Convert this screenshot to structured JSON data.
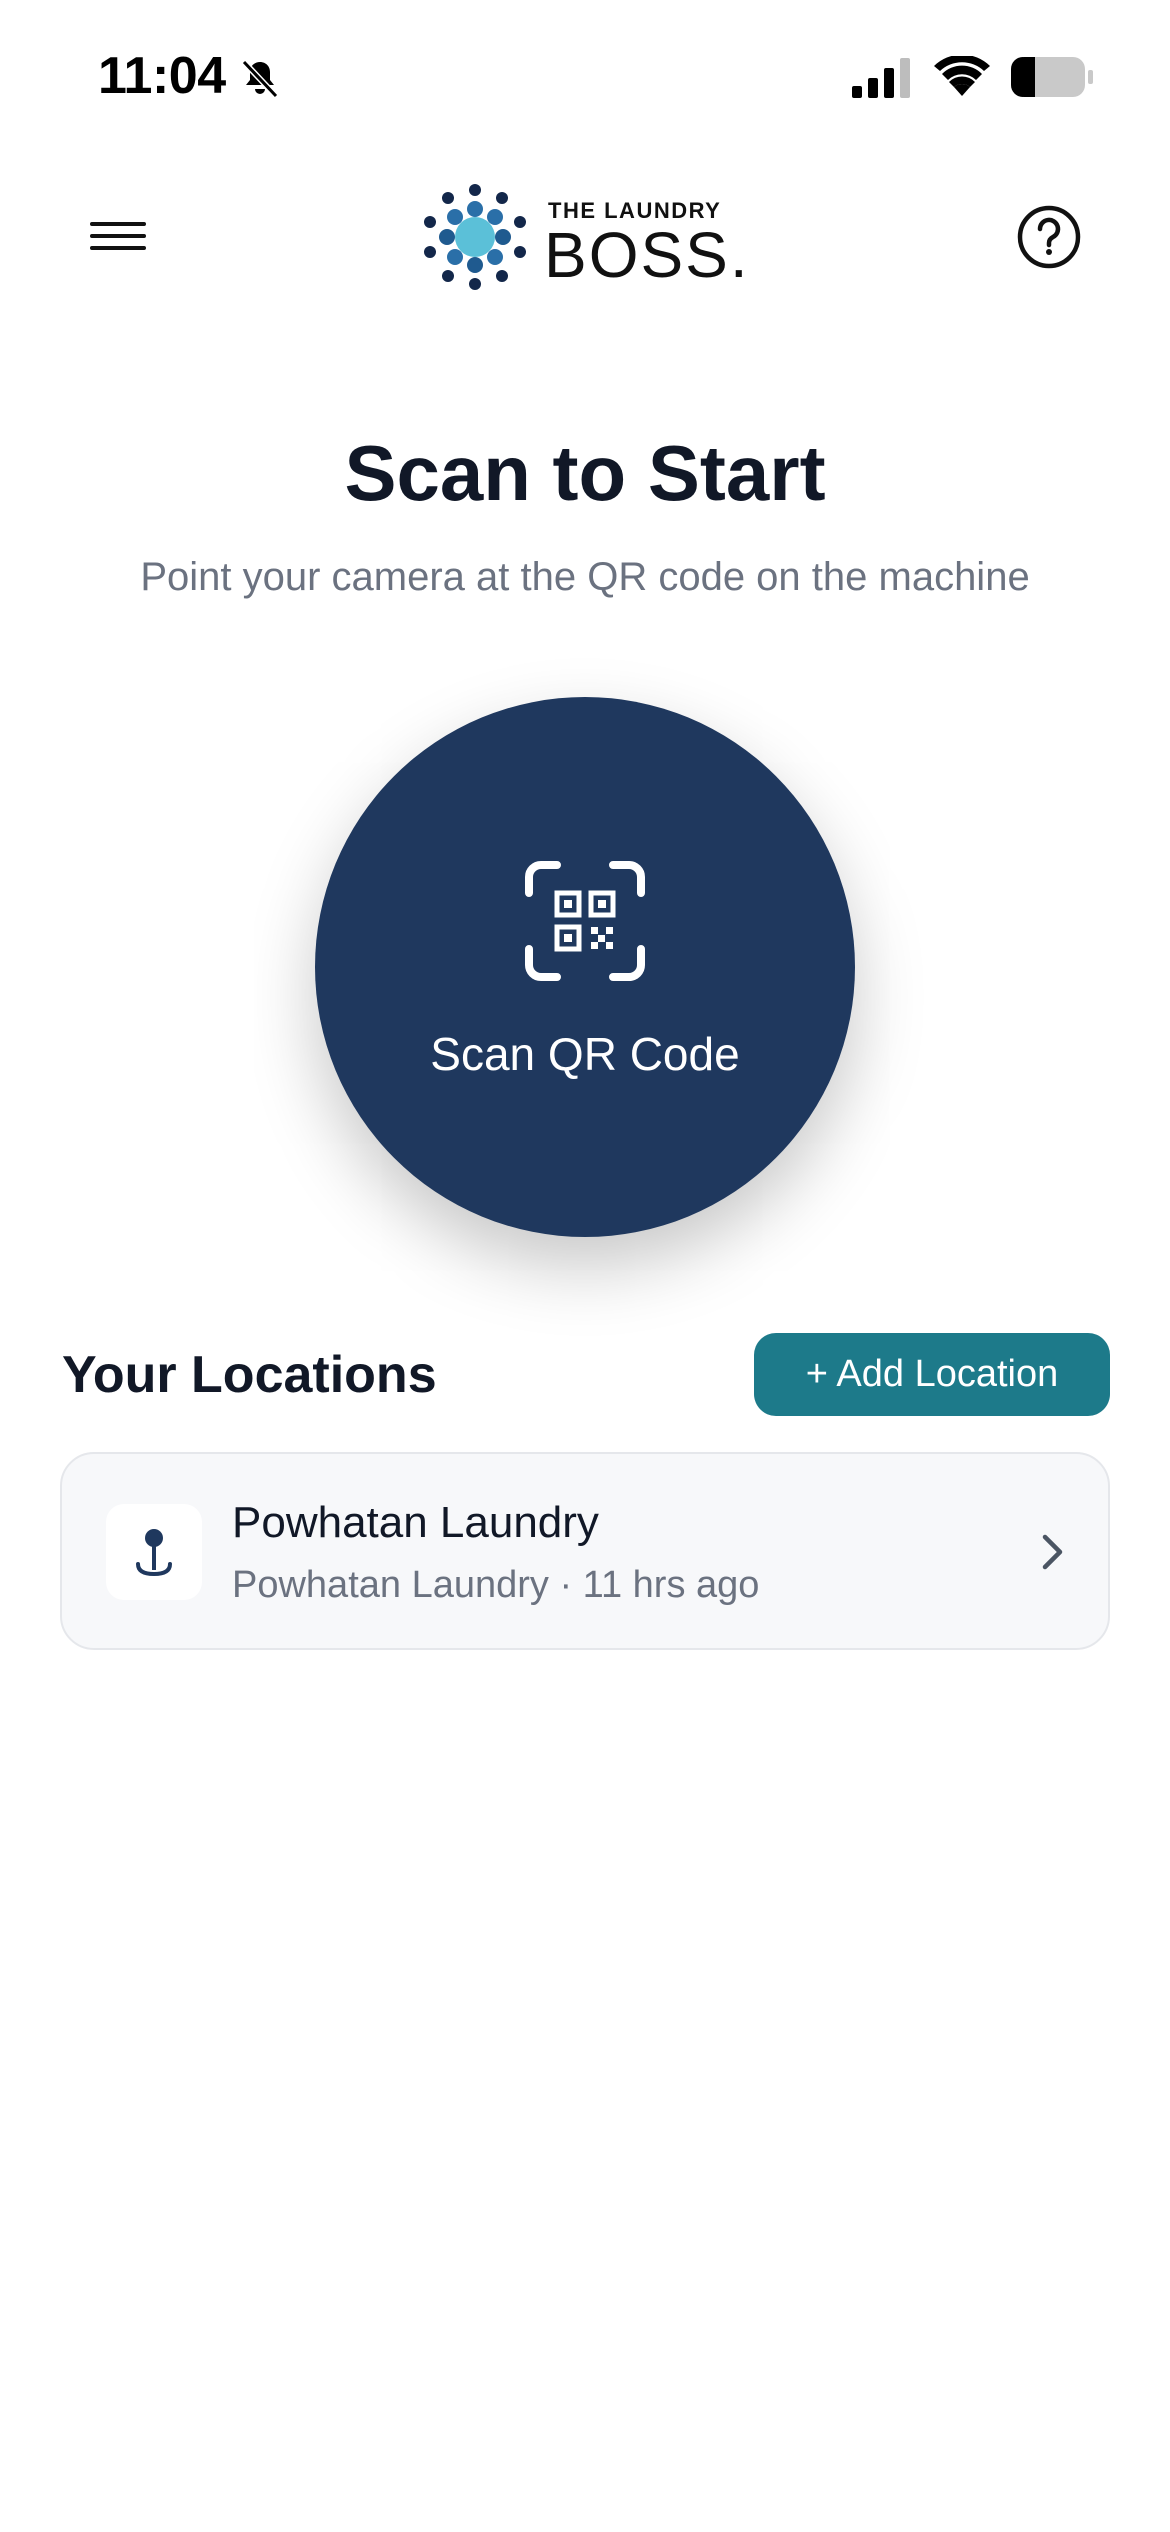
{
  "status_bar": {
    "time": "11:04"
  },
  "header": {
    "logo_top": "THE LAUNDRY",
    "logo_main": "BOSS."
  },
  "main": {
    "title": "Scan to Start",
    "subtitle": "Point your camera at the QR code on the machine",
    "scan_label": "Scan QR Code"
  },
  "locations": {
    "title": "Your Locations",
    "add_label": "+ Add Location",
    "items": [
      {
        "name": "Powhatan Laundry",
        "subtitle": "Powhatan Laundry · 11 hrs ago"
      }
    ]
  },
  "icons": {
    "menu": "hamburger-menu-icon",
    "help": "question-circle-icon",
    "qr": "qr-code-scan-icon",
    "location": "map-pin-icon",
    "chevron": "chevron-right-icon"
  },
  "colors": {
    "scan_button": "#1f385e",
    "add_location_button": "#1d7a8a",
    "subtitle_text": "#6b7280"
  }
}
